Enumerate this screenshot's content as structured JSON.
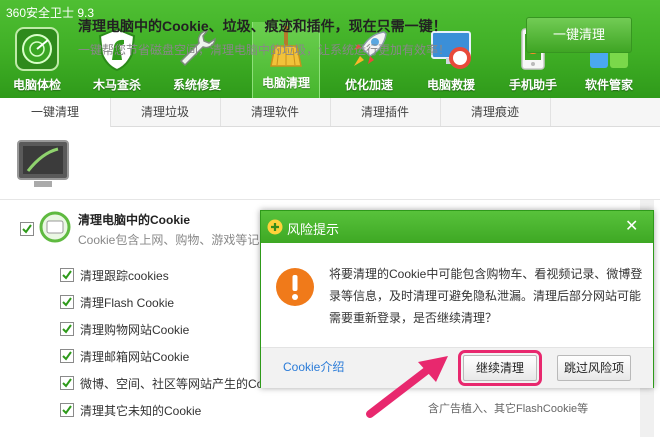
{
  "app": {
    "title": "360安全卫士 9.3"
  },
  "toolbar": [
    {
      "label": "电脑体检",
      "icon": "radar-icon"
    },
    {
      "label": "木马查杀",
      "icon": "horse-shield-icon"
    },
    {
      "label": "系统修复",
      "icon": "wrench-icon"
    },
    {
      "label": "电脑清理",
      "icon": "broom-icon",
      "active": true
    },
    {
      "label": "优化加速",
      "icon": "rocket-icon"
    },
    {
      "label": "电脑救援",
      "icon": "lifebuoy-monitor-icon"
    },
    {
      "label": "手机助手",
      "icon": "phone-icon"
    },
    {
      "label": "软件管家",
      "icon": "apps-grid-icon"
    }
  ],
  "tabs": [
    {
      "label": "一键清理",
      "active": true
    },
    {
      "label": "清理垃圾"
    },
    {
      "label": "清理软件"
    },
    {
      "label": "清理插件"
    },
    {
      "label": "清理痕迹"
    }
  ],
  "banner": {
    "title": "清理电脑中的Cookie、垃圾、痕迹和插件，现在只需一键！",
    "subtitle": "一键帮您节省磁盘空间，清理电脑中的垃圾，让系统运行更加有效率！",
    "button": "一键清理"
  },
  "group": {
    "title": "清理电脑中的Cookie",
    "desc": "Cookie包含上网、购物、游戏等记"
  },
  "items": [
    "清理跟踪cookies",
    "清理Flash Cookie",
    "清理购物网站Cookie",
    "清理邮箱网站Cookie",
    "微博、空间、社区等网站产生的Co",
    "清理其它未知的Cookie"
  ],
  "trailing_desc": "含广告植入、其它FlashCookie等",
  "dialog": {
    "title": "风险提示",
    "message": "将要清理的Cookie中可能包含购物车、看视频记录、微博登录等信息，及时清理可避免隐私泄漏。清理后部分网站可能需要重新登录，是否继续清理？",
    "link": "Cookie介绍",
    "continue": "继续清理",
    "skip": "跳过风险项"
  },
  "colors": {
    "brand_green": "#3fae25",
    "highlight": "#e8286e",
    "link": "#2a7bd8"
  }
}
